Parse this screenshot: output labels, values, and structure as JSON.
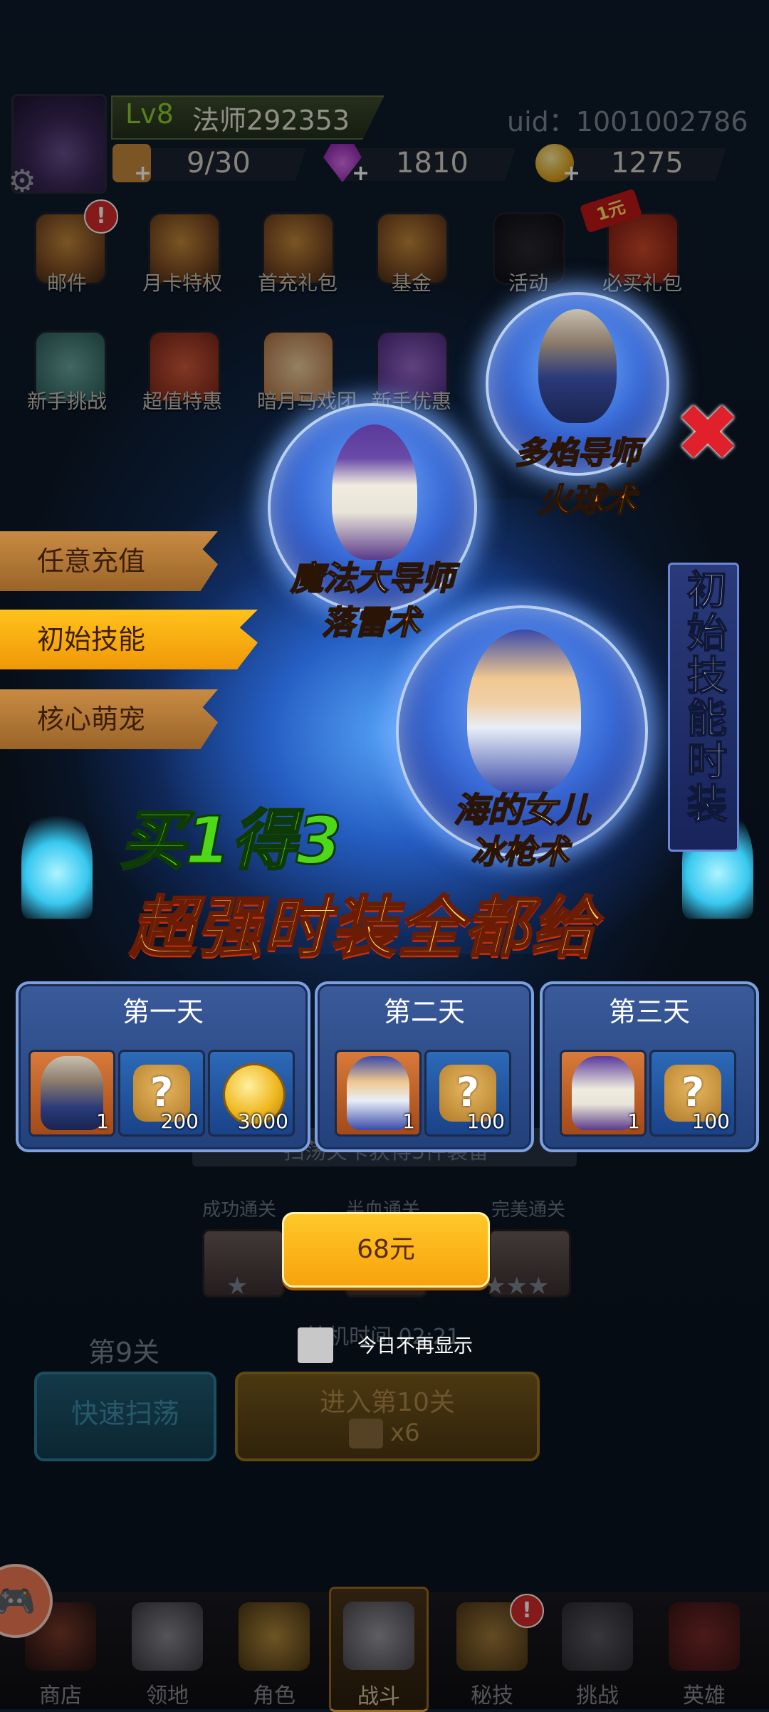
{
  "header": {
    "level": "Lv8",
    "player_name": "法师292353",
    "uid": "uid：1001002786",
    "resources": [
      {
        "icon": "chest-icon",
        "value": "9/30"
      },
      {
        "icon": "gem-icon",
        "value": "1810"
      },
      {
        "icon": "coin-icon",
        "value": "1275"
      }
    ]
  },
  "menu_row1": [
    "邮件",
    "月卡特权",
    "首充礼包",
    "基金",
    "活动",
    "必买礼包"
  ],
  "menu_row2": [
    "新手挑战",
    "超值特惠",
    "暗月马戏团",
    "新手优惠"
  ],
  "badges": {
    "mail": "!",
    "must_buy": "1元",
    "secret": "!"
  },
  "popup": {
    "tabs": [
      "任意充值",
      "初始技能",
      "核心萌宠"
    ],
    "active_tab": "初始技能",
    "orbs": [
      {
        "name": "多焰导师",
        "skill": "火球术"
      },
      {
        "name": "魔法大导师",
        "skill": "落雷术"
      },
      {
        "name": "海的女儿",
        "skill": "冰枪术"
      }
    ],
    "side_banner": "初始技能时装",
    "buy_slogan": "买1得3",
    "main_slogan": "超强时装全都给",
    "days": [
      {
        "title": "第一天",
        "items": [
          {
            "type": "hero",
            "qty": "1"
          },
          {
            "type": "puzzle",
            "qty": "200"
          },
          {
            "type": "coin",
            "qty": "3000"
          }
        ]
      },
      {
        "title": "第二天",
        "items": [
          {
            "type": "hero",
            "qty": "1"
          },
          {
            "type": "puzzle",
            "qty": "100"
          }
        ]
      },
      {
        "title": "第三天",
        "items": [
          {
            "type": "hero",
            "qty": "1"
          },
          {
            "type": "puzzle",
            "qty": "100"
          }
        ]
      }
    ],
    "price": "68元",
    "dont_show_today": "今日不再显示"
  },
  "game": {
    "sweep_hint": "扫荡关卡获得5件装备",
    "grades": [
      "成功通关",
      "半血通关",
      "完美通关"
    ],
    "timer_text": "挂机时间 02:21",
    "stage": "第9关",
    "sweep_button": "快速扫荡",
    "enter_button": "进入第10关",
    "enter_cost": "x6"
  },
  "nav": [
    "商店",
    "领地",
    "角色",
    "战斗",
    "秘技",
    "挑战",
    "英雄"
  ],
  "colors": {
    "active_tab": "#f7a30c",
    "price_button": "#ffc82a",
    "close": "#e0202a"
  }
}
